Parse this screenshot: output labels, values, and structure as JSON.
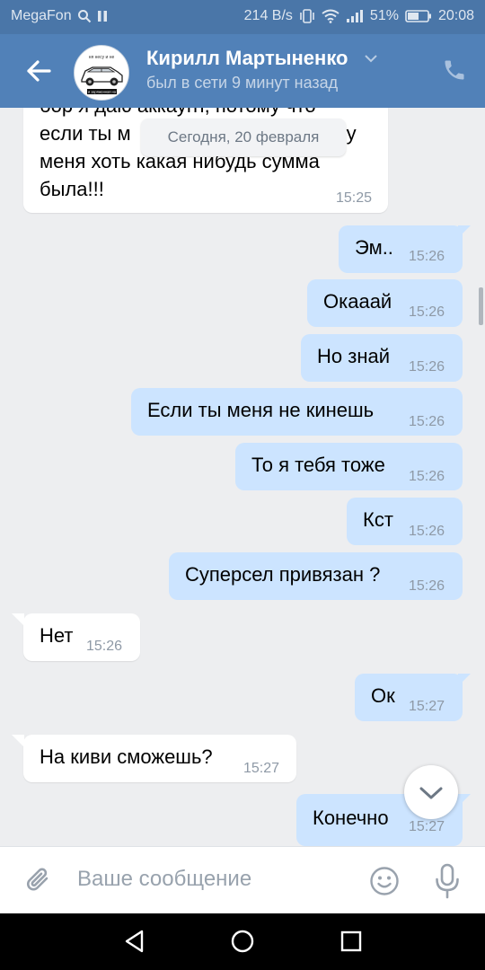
{
  "status_bar": {
    "carrier": "MegaFon",
    "speed": "214 B/s",
    "battery": "51%",
    "time": "20:08"
  },
  "header": {
    "name": "Кирилл Мартыненко",
    "status": "был в сети 9 минут назад",
    "avatar_caption_top": "ня несу и не",
    "avatar_caption_bottom": "и заряженная на"
  },
  "date_pill": "Сегодня, 20 февраля",
  "partial_message": {
    "lines": [
      "бор я даю аккаунт, потому что",
      "если ты м",
      "у",
      "меня хоть какая нибудь сумма",
      "была!!!"
    ],
    "time": "15:25"
  },
  "messages": [
    {
      "side": "out",
      "text": "Эм..",
      "time": "15:26"
    },
    {
      "side": "out",
      "text": "Окааай",
      "time": "15:26"
    },
    {
      "side": "out",
      "text": "Но знай",
      "time": "15:26"
    },
    {
      "side": "out",
      "text": "Если ты меня не кинешь",
      "time": "15:26"
    },
    {
      "side": "out",
      "text": "То я тебя тоже",
      "time": "15:26"
    },
    {
      "side": "out",
      "text": "Кст",
      "time": "15:26"
    },
    {
      "side": "out",
      "text": "Суперсел привязан ?",
      "time": "15:26"
    },
    {
      "side": "in",
      "text": "Нет",
      "time": "15:26"
    },
    {
      "side": "out",
      "text": "Ок",
      "time": "15:27"
    },
    {
      "side": "in",
      "text": "На киви сможешь?",
      "time": "15:27"
    },
    {
      "side": "out",
      "text": "Конечно",
      "time": "15:27"
    }
  ],
  "composer": {
    "placeholder": "Ваше сообщение"
  },
  "icons": {
    "back": "arrow-left-icon",
    "phone": "phone-icon",
    "scroll_down": "chevron-down-icon",
    "attach": "paperclip-icon",
    "emoji": "smile-icon",
    "voice": "microphone-icon"
  },
  "colors": {
    "header": "#5181b8",
    "outgoing_bubble": "#cce4ff",
    "incoming_bubble": "#ffffff",
    "chat_bg": "#edeef0"
  }
}
